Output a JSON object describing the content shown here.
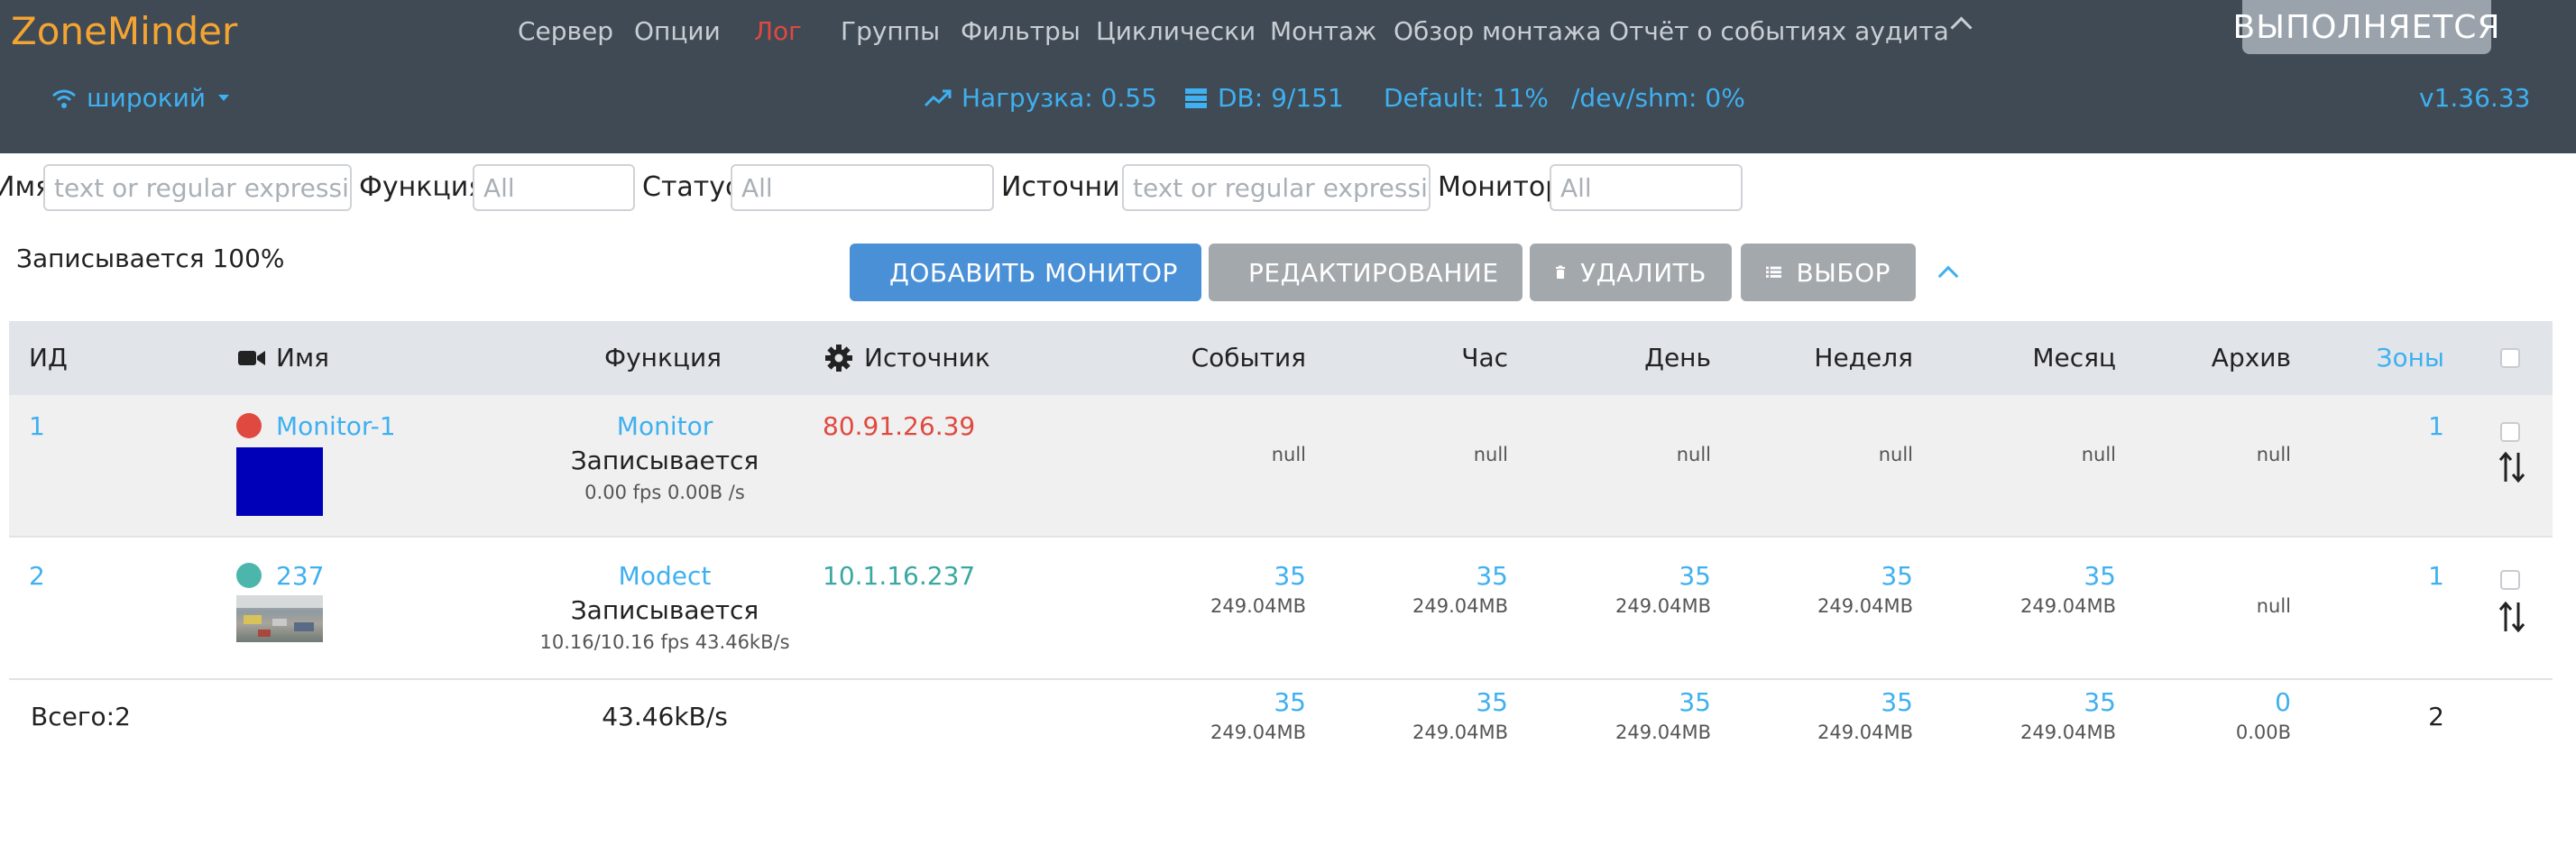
{
  "brand": "ZoneMinder",
  "nav": [
    "Сервер",
    "Опции",
    "Лог",
    "Группы",
    "Фильтры",
    "Циклически",
    "Монтаж",
    "Обзор монтажа",
    "Отчёт о событиях аудита"
  ],
  "nav_active": "Лог",
  "run_status": "ВЫПОЛНЯЕТСЯ",
  "width_selector": "широкий",
  "load": "Нагрузка: 0.55",
  "db": "DB: 9/151",
  "default_disk": "Default: 11%",
  "shm": "/dev/shm: 0%",
  "version": "v1.36.33",
  "filters": {
    "name_label": "Имя",
    "name_placeholder": "text or regular expressic",
    "function_label": "Функция",
    "function_value": "All",
    "status_label": "Статус",
    "status_value": "All",
    "source_label": "Источник",
    "source_placeholder": "text or regular expressic",
    "monitor_label": "Монитор",
    "monitor_value": "All"
  },
  "recording_pct": "Записывается 100%",
  "buttons": {
    "add": "ДОБАВИТЬ МОНИТОР",
    "edit": "РЕДАКТИРОВАНИЕ",
    "delete": "УДАЛИТЬ",
    "select": "ВЫБОР"
  },
  "columns": {
    "id": "ИД",
    "name": "Имя",
    "function": "Функция",
    "source": "Источник",
    "events": "События",
    "hour": "Час",
    "day": "День",
    "week": "Неделя",
    "month": "Месяц",
    "archive": "Архив",
    "zones": "Зоны"
  },
  "rows": [
    {
      "id": "1",
      "name": "Monitor-1",
      "status_color": "#e0493f",
      "function": "Monitor",
      "state": "Записывается",
      "fps": "0.00 fps 0.00B /s",
      "source": "80.91.26.39",
      "events": "",
      "events_size": "null",
      "hour": "",
      "hour_size": "null",
      "day": "",
      "day_size": "null",
      "week": "",
      "week_size": "null",
      "month": "",
      "month_size": "null",
      "archive": "",
      "archive_size": "null",
      "zones": "1"
    },
    {
      "id": "2",
      "name": "237",
      "status_color": "#4db6ac",
      "function": "Modect",
      "state": "Записывается",
      "fps": "10.16/10.16 fps 43.46kB/s",
      "source": "10.1.16.237",
      "events": "35",
      "events_size": "249.04MB",
      "hour": "35",
      "hour_size": "249.04MB",
      "day": "35",
      "day_size": "249.04MB",
      "week": "35",
      "week_size": "249.04MB",
      "month": "35",
      "month_size": "249.04MB",
      "archive": "",
      "archive_size": "null",
      "zones": "1"
    }
  ],
  "totals": {
    "label": "Всего:2",
    "bandwidth": "43.46kB/s",
    "events": "35",
    "events_size": "249.04MB",
    "hour": "35",
    "hour_size": "249.04MB",
    "day": "35",
    "day_size": "249.04MB",
    "week": "35",
    "week_size": "249.04MB",
    "month": "35",
    "month_size": "249.04MB",
    "archive": "0",
    "archive_size": "0.00B",
    "zones": "2"
  }
}
